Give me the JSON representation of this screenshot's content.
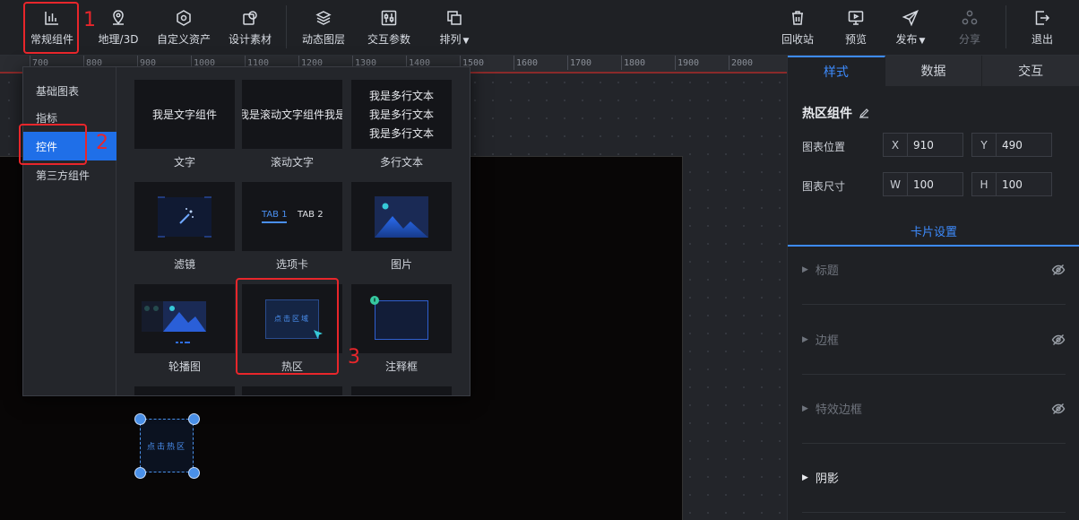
{
  "toolbar": {
    "left": [
      {
        "id": "common",
        "label": "常规组件",
        "icon": "bar-chart-icon"
      },
      {
        "id": "geo",
        "label": "地理/3D",
        "icon": "map-pin-icon"
      },
      {
        "id": "custom",
        "label": "自定义资产",
        "icon": "hexagon-icon"
      },
      {
        "id": "material",
        "label": "设计素材",
        "icon": "shapes-icon"
      },
      {
        "id": "layers",
        "label": "动态图层",
        "icon": "layers-icon"
      },
      {
        "id": "params",
        "label": "交互参数",
        "icon": "sliders-icon"
      },
      {
        "id": "arrange",
        "label": "排列",
        "icon": "arrange-icon"
      }
    ],
    "right": [
      {
        "id": "recycle",
        "label": "回收站",
        "icon": "trash-icon"
      },
      {
        "id": "preview",
        "label": "预览",
        "icon": "monitor-icon"
      },
      {
        "id": "publish",
        "label": "发布",
        "icon": "send-icon"
      },
      {
        "id": "share",
        "label": "分享",
        "icon": "share-icon"
      },
      {
        "id": "exit",
        "label": "退出",
        "icon": "exit-icon"
      }
    ]
  },
  "ruler": {
    "ticks": [
      "700",
      "800",
      "900",
      "1000",
      "1100",
      "1200",
      "1300",
      "1400",
      "1500",
      "1600",
      "1700",
      "1800",
      "1900",
      "2000"
    ]
  },
  "popup": {
    "categories": [
      {
        "label": "基础图表",
        "active": false
      },
      {
        "label": "指标",
        "active": false
      },
      {
        "label": "控件",
        "active": true
      },
      {
        "label": "第三方组件",
        "active": false
      }
    ],
    "cards": [
      {
        "name": "文字",
        "preview": "我是文字组件"
      },
      {
        "name": "滚动文字",
        "preview": "我是滚动文字组件我是"
      },
      {
        "name": "多行文本",
        "preview_lines": [
          "我是多行文本",
          "我是多行文本",
          "我是多行文本"
        ]
      },
      {
        "name": "滤镜"
      },
      {
        "name": "选项卡",
        "tab1": "TAB 1",
        "tab2": "TAB 2"
      },
      {
        "name": "图片"
      },
      {
        "name": "轮播图"
      },
      {
        "name": "热区",
        "preview": "点击区域"
      },
      {
        "name": "注释框"
      }
    ]
  },
  "canvas": {
    "widget_text": "点击热区"
  },
  "panel": {
    "tabs": [
      {
        "label": "样式",
        "active": true
      },
      {
        "label": "数据",
        "active": false
      },
      {
        "label": "交互",
        "active": false
      }
    ],
    "component_title": "热区组件",
    "position_label": "图表位置",
    "size_label": "图表尺寸",
    "x": {
      "key": "X",
      "value": "910"
    },
    "y": {
      "key": "Y",
      "value": "490"
    },
    "w": {
      "key": "W",
      "value": "100"
    },
    "h": {
      "key": "H",
      "value": "100"
    },
    "card_settings": "卡片设置",
    "sections": [
      {
        "label": "标题",
        "enabled": false
      },
      {
        "label": "边框",
        "enabled": false
      },
      {
        "label": "特效边框",
        "enabled": false
      },
      {
        "label": "阴影",
        "enabled": true
      }
    ]
  },
  "annotations": [
    "1",
    "2",
    "3"
  ],
  "colors": {
    "accent": "#3d8bfd",
    "annotation": "#e8262b",
    "active_category": "#1f6fe8"
  }
}
